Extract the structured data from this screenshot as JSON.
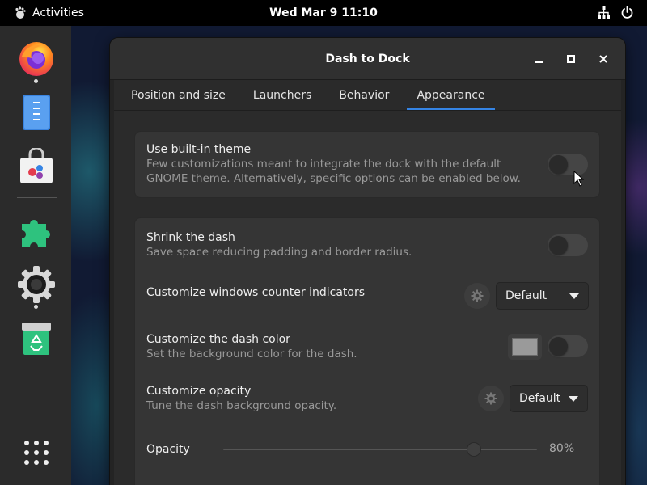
{
  "topbar": {
    "activities_label": "Activities",
    "clock": "Wed Mar 9  11:10",
    "icons": [
      "network-icon",
      "power-icon"
    ]
  },
  "dock": {
    "apps": [
      "firefox-icon",
      "files-icon",
      "software-icon",
      "extensions-icon",
      "settings-icon",
      "trash-icon"
    ],
    "show_apps_icon": "app-grid-icon"
  },
  "window": {
    "title": "Dash to Dock",
    "tabs": [
      {
        "label": "Position and size"
      },
      {
        "label": "Launchers"
      },
      {
        "label": "Behavior"
      },
      {
        "label": "Appearance"
      }
    ],
    "active_tab": "Appearance",
    "builtin_theme": {
      "label": "Use built-in theme",
      "description_line1": "Few customizations meant to integrate the dock with the default",
      "description_line2": "GNOME theme. Alternatively, specific options can be enabled below.",
      "enabled": false
    },
    "shrink_dash": {
      "label": "Shrink the dash",
      "description": "Save space reducing padding and border radius.",
      "enabled": false
    },
    "counter_indicators": {
      "label": "Customize windows counter indicators",
      "value": "Default"
    },
    "dash_color": {
      "label": "Customize the dash color",
      "description": "Set the background color for the dash.",
      "color": "#9a9a9a",
      "enabled": false
    },
    "opacity_mode": {
      "label": "Customize opacity",
      "description": "Tune the dash background opacity.",
      "value": "Default"
    },
    "opacity": {
      "label": "Opacity",
      "value_text": "80%",
      "value": 0.8
    }
  },
  "colors": {
    "accent": "#3584e4",
    "topbar": "#000000",
    "dock": "#2b2b2b"
  }
}
